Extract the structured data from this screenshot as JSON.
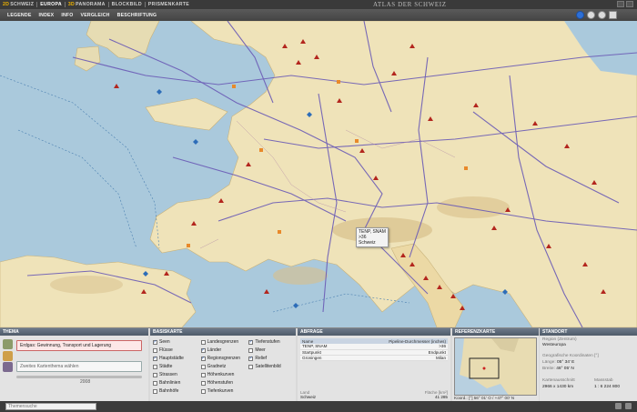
{
  "top_tabs": [
    {
      "prefix": "2D",
      "label": "SCHWEIZ"
    },
    {
      "prefix": "",
      "label": "EUROPA"
    },
    {
      "prefix": "3D",
      "label": "PANORAMA"
    },
    {
      "prefix": "",
      "label": "BLOCKBILD"
    },
    {
      "prefix": "",
      "label": "PRISMENKARTE"
    }
  ],
  "app_title": "ATLAS DER SCHWEIZ",
  "menu": [
    "LEGENDE",
    "INDEX",
    "INFO",
    "VERGLEICH",
    "BESCHRIFTUNG"
  ],
  "tooltip": {
    "line1": "TENP, SNAM",
    "line2": ">36",
    "line3": "Schweiz"
  },
  "thema": {
    "header": "THEMA",
    "primary": "Erdgas: Gewinnung, Transport und Lagerung",
    "secondary": "Zweites Kartenthema wählen",
    "year": "2008"
  },
  "basiskarte": {
    "header": "BASISKARTE",
    "items": [
      {
        "label": "Seen",
        "checked": true
      },
      {
        "label": "Landesgrenzen",
        "checked": false
      },
      {
        "label": "Tiefenstufen",
        "checked": true
      },
      {
        "label": "Flüsse",
        "checked": false
      },
      {
        "label": "Länder",
        "checked": true
      },
      {
        "label": "Meer",
        "checked": false
      },
      {
        "label": "Hauptstädte",
        "checked": true
      },
      {
        "label": "Regionsgrenzen",
        "checked": true
      },
      {
        "label": "Relief",
        "checked": true
      },
      {
        "label": "Städte",
        "checked": false
      },
      {
        "label": "Gradnetz",
        "checked": false
      },
      {
        "label": "Satellitenbild",
        "checked": false
      },
      {
        "label": "Strassen",
        "checked": false
      },
      {
        "label": "Höhenkurven",
        "checked": false
      },
      {
        "label": "",
        "checked": false
      },
      {
        "label": "Bahnlinien",
        "checked": false
      },
      {
        "label": "Höhenstufen",
        "checked": false
      },
      {
        "label": "",
        "checked": false
      },
      {
        "label": "Bahnhöfe",
        "checked": false
      },
      {
        "label": "Tiefenkurven",
        "checked": false
      },
      {
        "label": "",
        "checked": false
      }
    ]
  },
  "abfrage": {
    "header": "ABFRAGE",
    "col1": "Name",
    "col2": "Pipeline-Durchmesser (inches)",
    "rows": [
      {
        "name": "TENP, SNAM",
        "value": ">36"
      },
      {
        "name": "Startpunkt",
        "value": "Endpunkt"
      },
      {
        "name": "Groningen",
        "value": "Milan"
      }
    ],
    "foot_label_left": "Land",
    "foot_label_right": "Fläche [km²]",
    "foot_value_left": "Schweiz",
    "foot_value_right": "41 285"
  },
  "referenzkarte": {
    "header": "REFERENZKARTE",
    "coord": "Koord.: [°]  56° 01' O  / +47° 00' N"
  },
  "standort": {
    "header": "STANDORT",
    "region_label": "Region (Zentrum)",
    "region": "Westeuropa",
    "coord_label": "Geografische Koordinaten [°]",
    "laenge_label": "Länge:",
    "laenge": "05° 34' E",
    "breite_label": "Breite:",
    "breite": "46° 05' N",
    "ausschnitt_label": "Kartenausschnitt",
    "ausschnitt": "2966 x 1430 km",
    "massstab_label": "Massstab",
    "massstab": "1 : 6 224 800"
  },
  "search_placeholder": "Themensuche"
}
